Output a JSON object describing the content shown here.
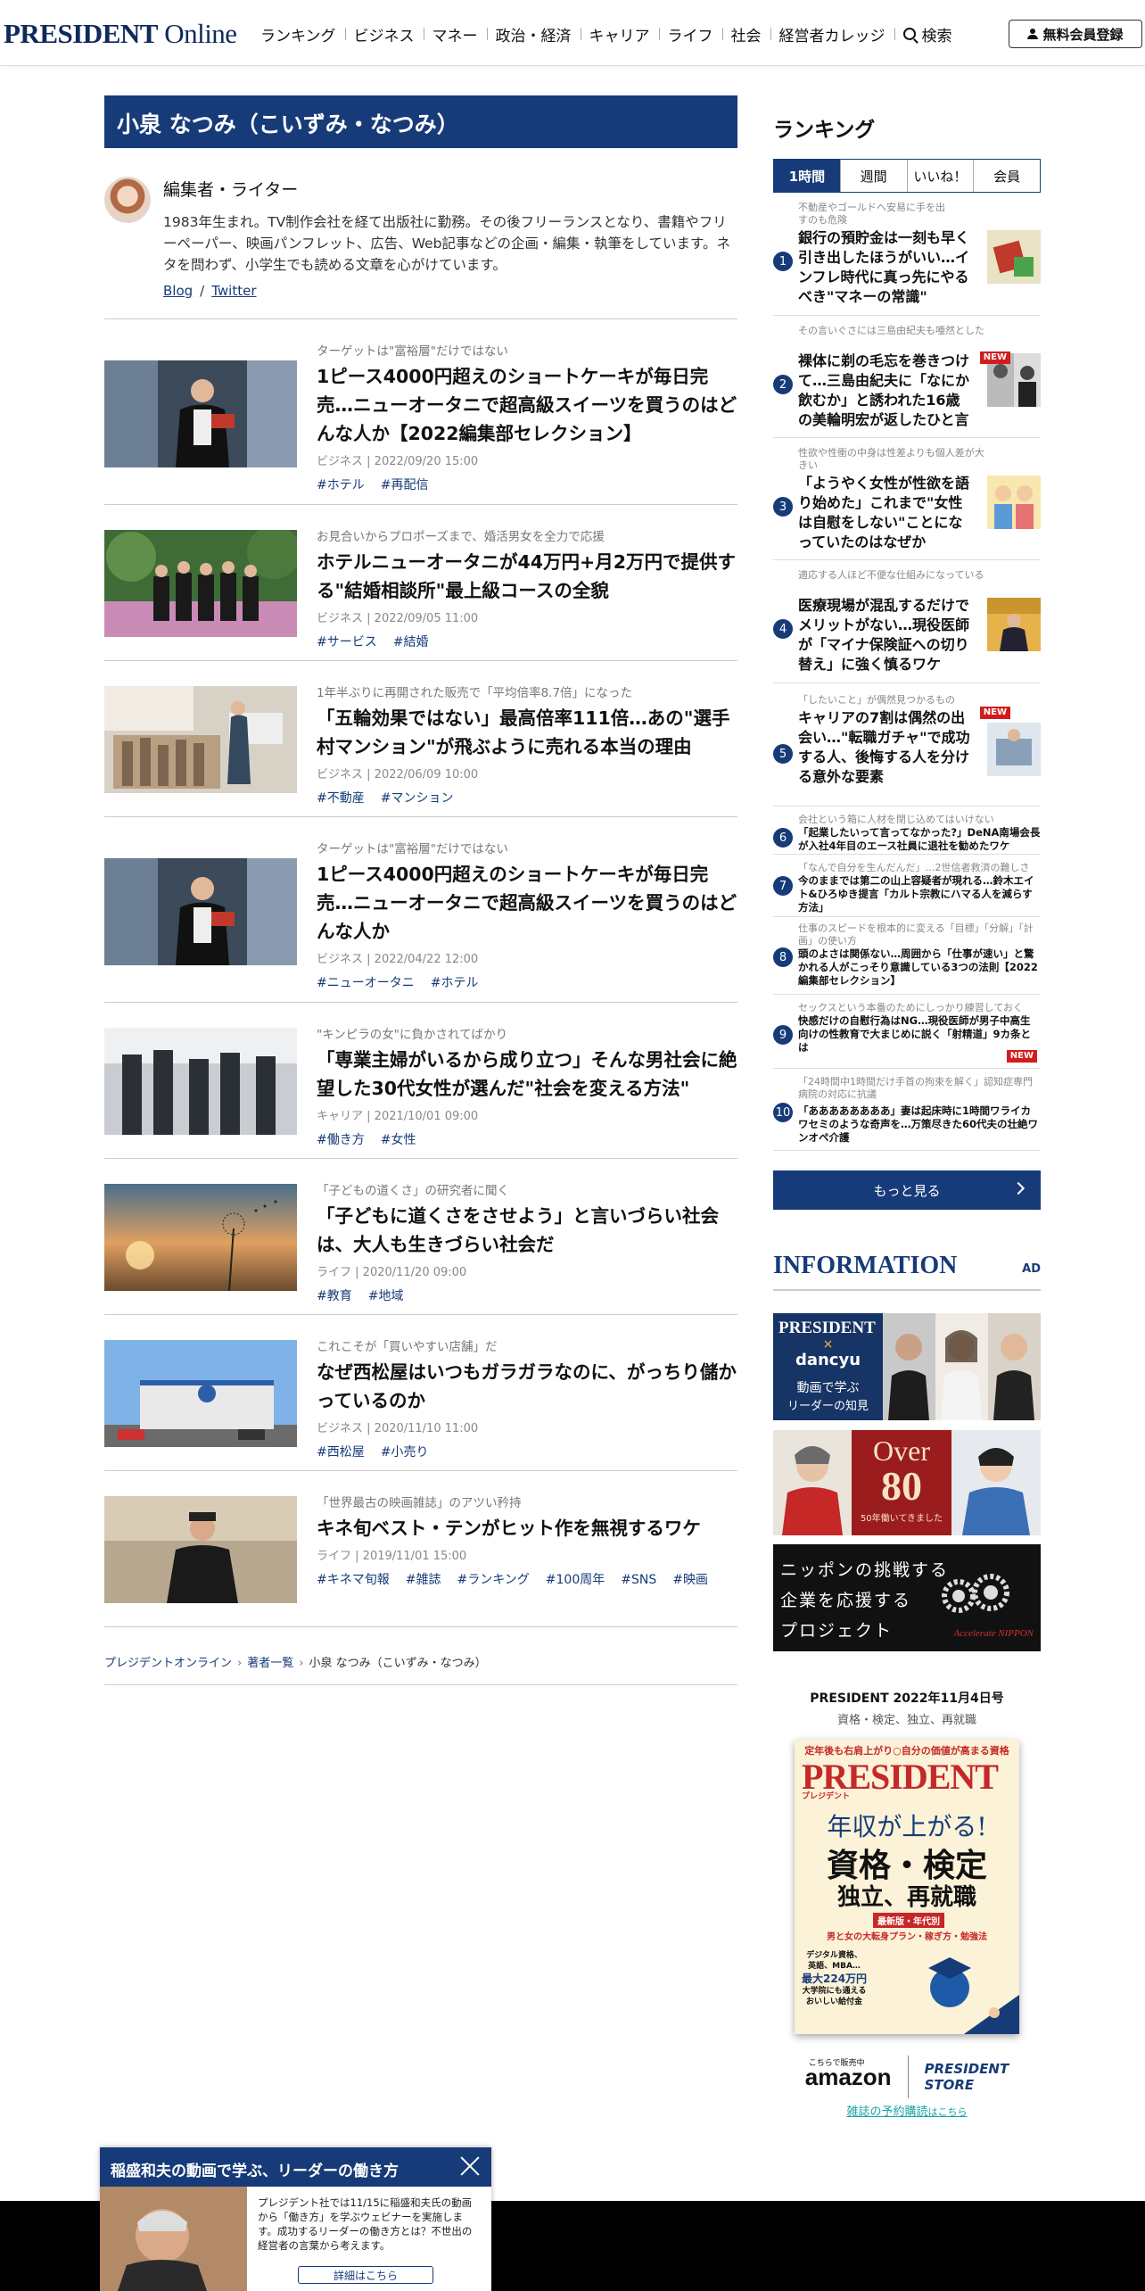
{
  "header": {
    "logo_main": "PRESIDENT",
    "logo_sub": " Online",
    "nav": [
      "ランキング",
      "ビジネス",
      "マネー",
      "政治・経済",
      "キャリア",
      "ライフ",
      "社会",
      "経営者カレッジ"
    ],
    "search_label": "検索",
    "register_label": "無料会員登録"
  },
  "author": {
    "name": "小泉 なつみ（こいずみ・なつみ）",
    "role": "編集者・ライター",
    "bio": "1983年生まれ。TV制作会社を経て出版社に勤務。その後フリーランスとなり、書籍やフリーペーパー、映画パンフレット、広告、Web記事などの企画・編集・執筆をしています。ネタを問わず、小学生でも読める文章を心がけています。",
    "link_blog": "Blog",
    "link_sep": "/",
    "link_twitter": "Twitter"
  },
  "articles": [
    {
      "kicker": "ターゲットは\"富裕層\"だけではない",
      "title": "1ピース4000円超えのショートケーキが毎日完売…ニューオータニで超高級スイーツを買うのはどんな人か【2022編集部セレクション】",
      "category": "ビジネス",
      "date": "2022/09/20 15:00",
      "tags": [
        "#ホテル",
        "#再配信"
      ]
    },
    {
      "kicker": "お見合いからプロポーズまで、婚活男女を全力で応援",
      "title": "ホテルニューオータニが44万円+月2万円で提供する\"結婚相談所\"最上級コースの全貌",
      "category": "ビジネス",
      "date": "2022/09/05 11:00",
      "tags": [
        "#サービス",
        "#結婚"
      ]
    },
    {
      "kicker": "1年半ぶりに再開された販売で「平均倍率8.7倍」になった",
      "title": "「五輪効果ではない」最高倍率111倍…あの\"選手村マンション\"が飛ぶように売れる本当の理由",
      "category": "ビジネス",
      "date": "2022/06/09 10:00",
      "tags": [
        "#不動産",
        "#マンション"
      ]
    },
    {
      "kicker": "ターゲットは\"富裕層\"だけではない",
      "title": "1ピース4000円超えのショートケーキが毎日完売…ニューオータニで超高級スイーツを買うのはどんな人か",
      "category": "ビジネス",
      "date": "2022/04/22 12:00",
      "tags": [
        "#ニューオータニ",
        "#ホテル"
      ]
    },
    {
      "kicker": "\"キンピラの女\"に負かされてばかり",
      "title": "「専業主婦がいるから成り立つ」そんな男社会に絶望した30代女性が選んだ\"社会を変える方法\"",
      "category": "キャリア",
      "date": "2021/10/01 09:00",
      "tags": [
        "#働き方",
        "#女性"
      ]
    },
    {
      "kicker": "「子どもの道くさ」の研究者に聞く",
      "title": "「子どもに道くさをさせよう」と言いづらい社会は、大人も生きづらい社会だ",
      "category": "ライフ",
      "date": "2020/11/20 09:00",
      "tags": [
        "#教育",
        "#地域"
      ]
    },
    {
      "kicker": "これこそが「買いやすい店舗」だ",
      "title": "なぜ西松屋はいつもガラガラなのに、がっちり儲かっているのか",
      "category": "ビジネス",
      "date": "2020/11/10 11:00",
      "tags": [
        "#西松屋",
        "#小売り"
      ]
    },
    {
      "kicker": "「世界最古の映画雑誌」のアツい矜持",
      "title": "キネ旬ベスト・テンがヒット作を無視するワケ",
      "category": "ライフ",
      "date": "2019/11/01 15:00",
      "tags": [
        "#キネマ旬報",
        "#雑誌",
        "#ランキング",
        "#100周年",
        "#SNS",
        "#映画"
      ]
    }
  ],
  "breadcrumb": {
    "home": "プレジデントオンライン",
    "list": "著者一覧",
    "current": "小泉 なつみ（こいずみ・なつみ）"
  },
  "ranking": {
    "heading": "ランキング",
    "tabs": [
      "1時間",
      "週間",
      "いいね！",
      "会員"
    ],
    "items": [
      {
        "num": "1",
        "kicker": "不動産やゴールドへ安易に手を出すのも危険",
        "title": "銀行の預貯金は一刻も早く引き出したほうがいい…インフレ時代に真っ先にやるべき\"マネーの常識\""
      },
      {
        "num": "2",
        "kicker": "その言いぐさには三島由紀夫も唖然とした",
        "title": "裸体に剃の毛忘を巻きつけて…三島由紀夫に「なにか飲むか」と誘われた16歳の美輪明宏が返したひと言",
        "badge": "NEW"
      },
      {
        "num": "3",
        "kicker": "性欲や性衝の中身は性差よりも個人差が大きい",
        "title": "「ようやく女性が性欲を語り始めた」これまで\"女性は自慰をしない\"ことになっていたのはなぜか"
      },
      {
        "num": "4",
        "kicker": "適応する人ほど不便な仕組みになっている",
        "title": "医療現場が混乱するだけでメリットがない…現役医師が「マイナ保険証への切り替え」に強く慎るワケ"
      },
      {
        "num": "5",
        "kicker": "「したいこと」が偶然見つかるもの",
        "title": "キャリアの7割は偶然の出会い…\"転職ガチャ\"で成功する人、後悔する人を分ける意外な要素",
        "badge": "NEW"
      },
      {
        "num": "6",
        "kicker": "会社という箱に人材を閉じ込めてはいけない",
        "title": "「起業したいって言ってなかった?」DeNA南場会長が入社4年目のエース社員に退社を勧めたワケ"
      },
      {
        "num": "7",
        "kicker": "「なんで自分を生んだんだ」…2世信者救済の難しさ",
        "title": "今のままでは第二の山上容疑者が現れる…鈴木エイト&ひろゆき提言「カルト宗教にハマる人を減らす方法」"
      },
      {
        "num": "8",
        "kicker": "仕事のスピードを根本的に変える「目標」「分解」「計画」の使い方",
        "title": "頭のよさは関係ない…周囲から「仕事が速い」と驚かれる人がこっそり意識している3つの法則【2022編集部セレクション】"
      },
      {
        "num": "9",
        "kicker": "セックスという本番のためにしっかり練習しておく",
        "title": "快感だけの自慰行為はNG…現役医師が男子中高生向けの性教育で大まじめに説く「射精道」9カ条とは",
        "badge": "NEW"
      },
      {
        "num": "10",
        "kicker": "「24時間中1時間だけ手首の拘束を解く」認知症専門病院の対応に抗議",
        "title": "「ああああああああ」妻は起床時に1時間ワライカワセミのような奇声を…万策尽きた60代夫の壮絶ワンオペ介護"
      }
    ],
    "more_label": "もっと見る"
  },
  "information": {
    "heading": "INFORMATION",
    "ad_label": "AD",
    "promo1_brand": "PRESIDENT",
    "promo1_x": "×",
    "promo1_partner": "dancyu",
    "promo1_line1": "動画で学ぶ",
    "promo1_line2": "リーダーの知見",
    "promo2_big": "Over",
    "promo2_num": "80",
    "promo2_sub": "50年働いてきました",
    "promo3_line1": "ニッポンの挑戦する",
    "promo3_line2": "企業を応援する",
    "promo3_line3": "プロジェクト",
    "promo3_brand": "Accelerate NIPPON"
  },
  "magazine": {
    "title": "PRESIDENT 2022年11月4日号",
    "subtitle": "資格・検定、独立、再就職",
    "cover_tagline": "定年後も右肩上がり○自分の価値が高まる資格",
    "cover_logo": "PRESIDENT",
    "cover_logo_kana": "プレジデント",
    "cover_head1": "年収が上がる!",
    "cover_head2": "資格・検定",
    "cover_head3": "独立、再就職",
    "cover_badge": "最新版・年代別",
    "cover_note": "男と女の大転身プラン・稼ぎ方・勉強法",
    "cover_side1": "デジタル資格、",
    "cover_side2": "英語、MBA…",
    "cover_side3": "最大224万円",
    "cover_side4": "大学院にも通える",
    "cover_side5": "おいしい給付金",
    "store_amazon_note": "こちらで販売中",
    "store_amazon": "amazon",
    "store_pres_1": "PRESIDENT",
    "store_pres_2": "STORE",
    "subscribe_link": "雑誌の予約購読",
    "subscribe_suffix": "はこちら"
  },
  "popup": {
    "title": "稲盛和夫の動画で学ぶ、リーダーの働き方",
    "body": "プレジデント社では11/15に稲盛和夫氏の動画から「働き方」を学ぶウェビナーを実施します。成功するリーダーの働き方とは？不世出の経営者の言葉から考えます。",
    "button": "詳細はこちら"
  },
  "colors": {
    "brand_navy": "#163b78",
    "new_badge": "#d21d1d",
    "link_teal": "#1aa3a3"
  }
}
